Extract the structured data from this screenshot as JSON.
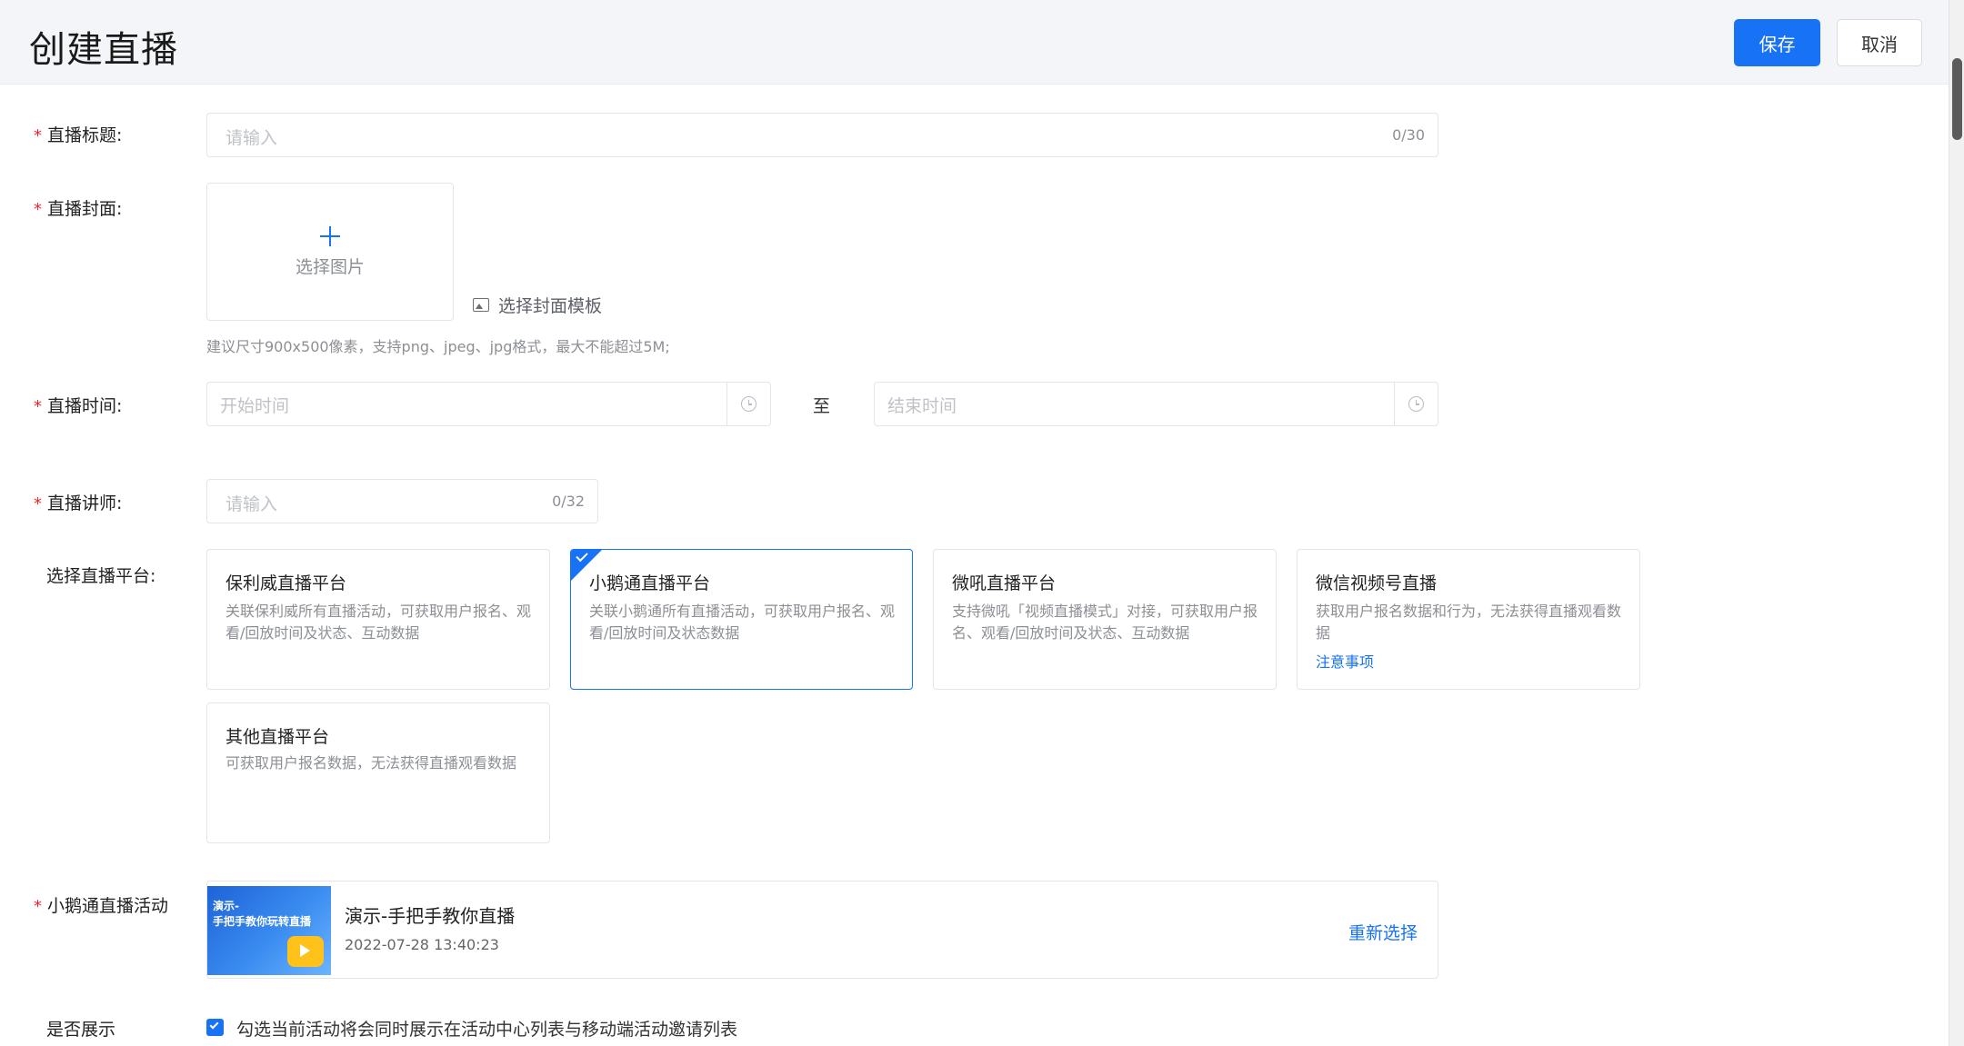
{
  "header": {
    "title": "创建直播",
    "save_label": "保存",
    "cancel_label": "取消"
  },
  "form": {
    "title_field": {
      "label": "直播标题:",
      "placeholder": "请输入",
      "counter": "0/30"
    },
    "cover": {
      "label": "直播封面:",
      "upload_text": "选择图片",
      "template_link": "选择封面模板",
      "hint": "建议尺寸900x500像素，支持png、jpeg、jpg格式，最大不能超过5M;"
    },
    "time": {
      "label": "直播时间:",
      "start_placeholder": "开始时间",
      "separator": "至",
      "end_placeholder": "结束时间"
    },
    "lecturer": {
      "label": "直播讲师:",
      "placeholder": "请输入",
      "counter": "0/32"
    },
    "platform": {
      "label": "选择直播平台:",
      "cards": [
        {
          "title": "保利威直播平台",
          "desc": "关联保利威所有直播活动，可获取用户报名、观看/回放时间及状态、互动数据",
          "selected": false
        },
        {
          "title": "小鹅通直播平台",
          "desc": "关联小鹅通所有直播活动，可获取用户报名、观看/回放时间及状态数据",
          "selected": true
        },
        {
          "title": "微吼直播平台",
          "desc": "支持微吼「视频直播模式」对接，可获取用户报名、观看/回放时间及状态、互动数据",
          "selected": false
        },
        {
          "title": "微信视频号直播",
          "desc": "获取用户报名数据和行为，无法获得直播观看数据",
          "link": "注意事项",
          "selected": false
        },
        {
          "title": "其他直播平台",
          "desc": "可获取用户报名数据，无法获得直播观看数据",
          "selected": false
        }
      ]
    },
    "activity": {
      "label": "小鹅通直播活动",
      "thumb_text": "演示-\n手把手教你玩转直播",
      "title": "演示-手把手教你直播",
      "time": "2022-07-28 13:40:23",
      "reselect": "重新选择"
    },
    "display": {
      "label": "是否展示",
      "checked": true,
      "checkbox_label": "勾选当前活动将会同时展示在活动中心列表与移动端活动邀请列表"
    }
  },
  "colors": {
    "primary": "#1772f6",
    "required": "#f5222d",
    "header_bg": "#f3f5f8"
  }
}
